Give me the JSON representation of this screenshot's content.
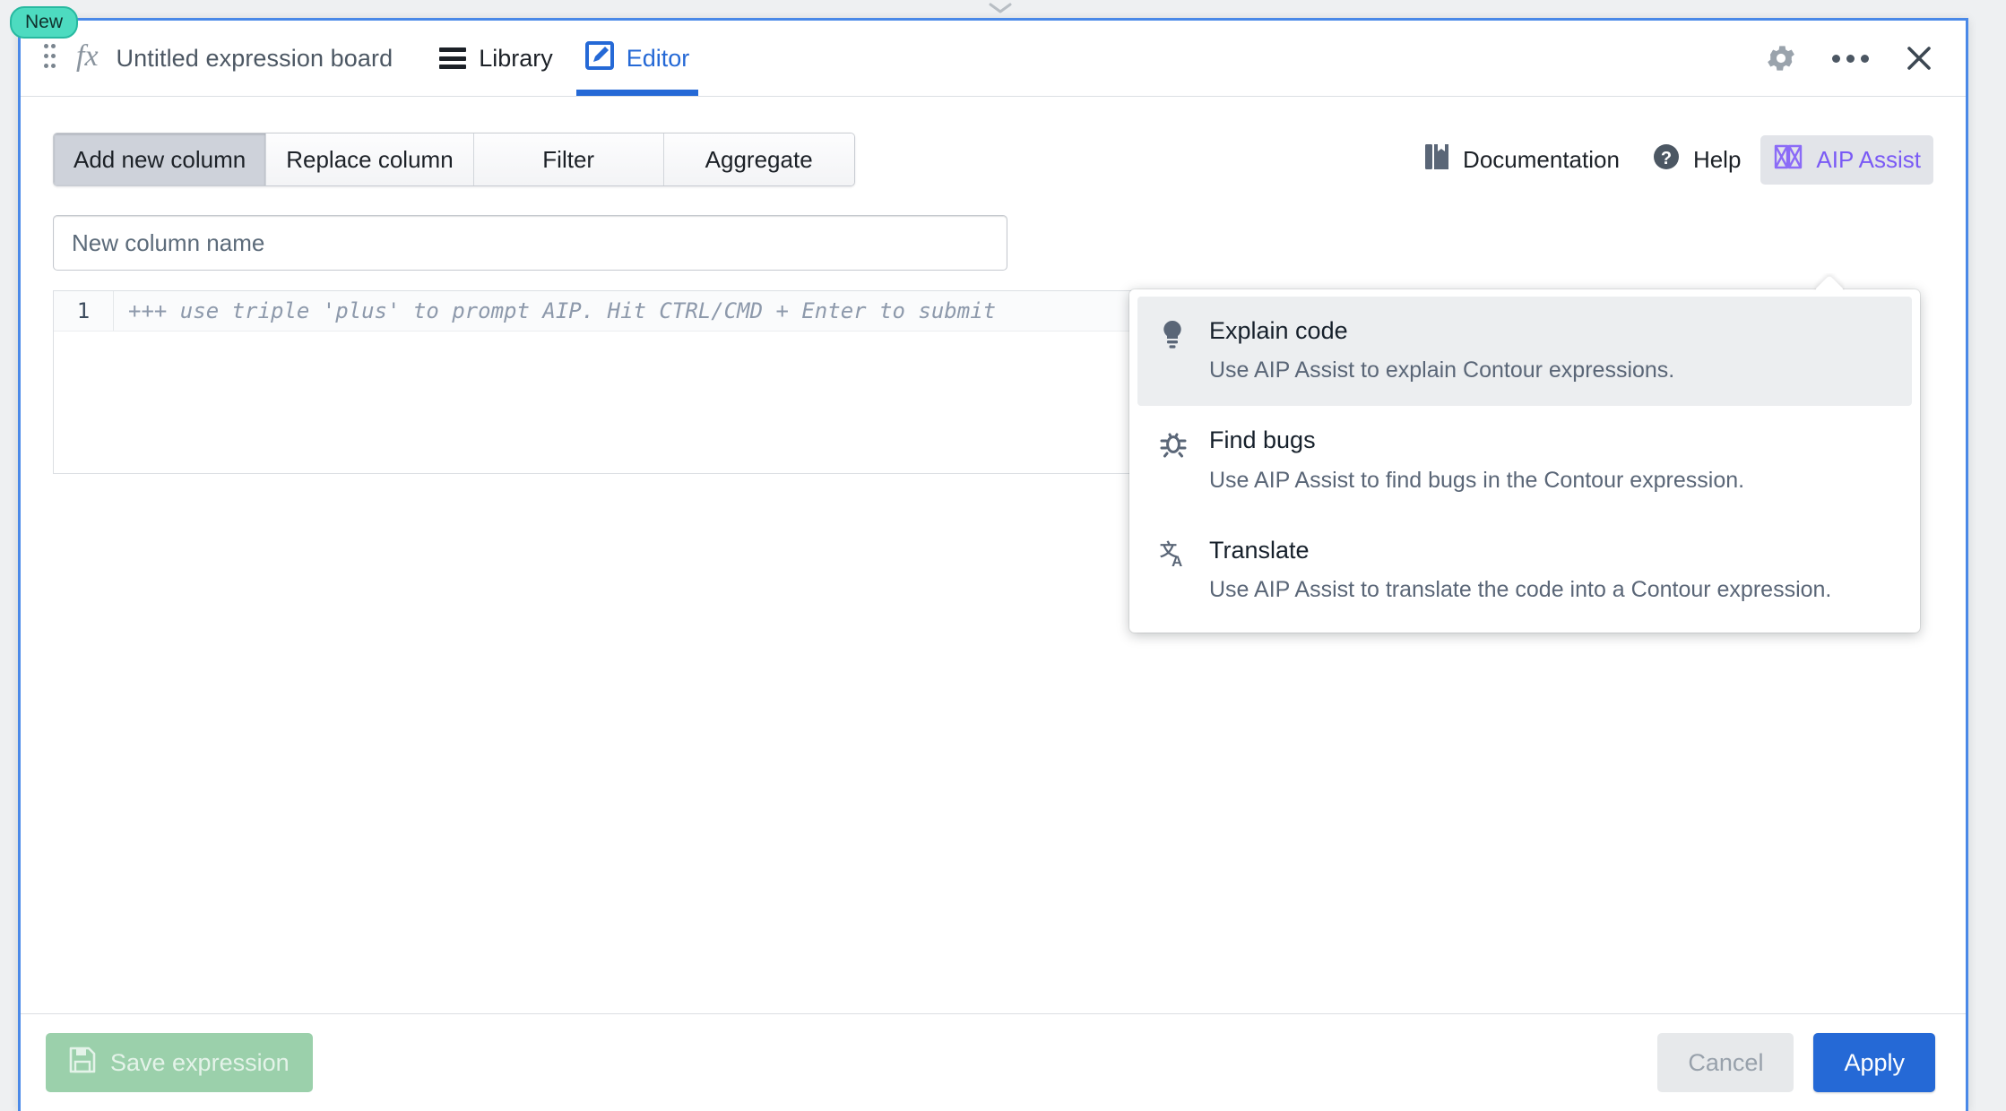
{
  "window": {
    "badge": "New",
    "fx_icon": "fx-icon",
    "title": "Untitled expression board",
    "tabs": [
      {
        "label": "Library",
        "icon": "hamburger-icon",
        "active": false
      },
      {
        "label": "Editor",
        "icon": "edit-pencil-icon",
        "active": true
      }
    ],
    "actions": [
      {
        "name": "settings",
        "icon": "gear-icon"
      },
      {
        "name": "more",
        "icon": "more-dots-icon"
      },
      {
        "name": "close",
        "icon": "close-icon"
      }
    ]
  },
  "toolbar": {
    "modes": [
      {
        "label": "Add new column",
        "active": true
      },
      {
        "label": "Replace column",
        "active": false
      },
      {
        "label": "Filter",
        "active": false
      },
      {
        "label": "Aggregate",
        "active": false
      }
    ],
    "documentation_label": "Documentation",
    "help_label": "Help",
    "aip_label": "AIP Assist"
  },
  "form": {
    "column_name_placeholder": "New column name",
    "column_name_value": "",
    "code_line_number": "1",
    "code_placeholder": "+++ use triple 'plus' to prompt AIP. Hit CTRL/CMD + Enter to submit"
  },
  "aip_menu": {
    "items": [
      {
        "title": "Explain code",
        "desc": "Use AIP Assist to explain Contour expressions.",
        "icon": "lightbulb-icon",
        "highlighted": true
      },
      {
        "title": "Find bugs",
        "desc": "Use AIP Assist to find bugs in the Contour expression.",
        "icon": "bug-icon",
        "highlighted": false
      },
      {
        "title": "Translate",
        "desc": "Use AIP Assist to translate the code into a Contour expression.",
        "icon": "translate-icon",
        "highlighted": false
      }
    ]
  },
  "footer": {
    "save_label": "Save expression",
    "cancel_label": "Cancel",
    "apply_label": "Apply"
  },
  "colors": {
    "accent": "#2569d6",
    "aip_purple": "#7a5af5",
    "badge_teal": "#4ddbc0",
    "save_green": "#9bd0ab"
  }
}
